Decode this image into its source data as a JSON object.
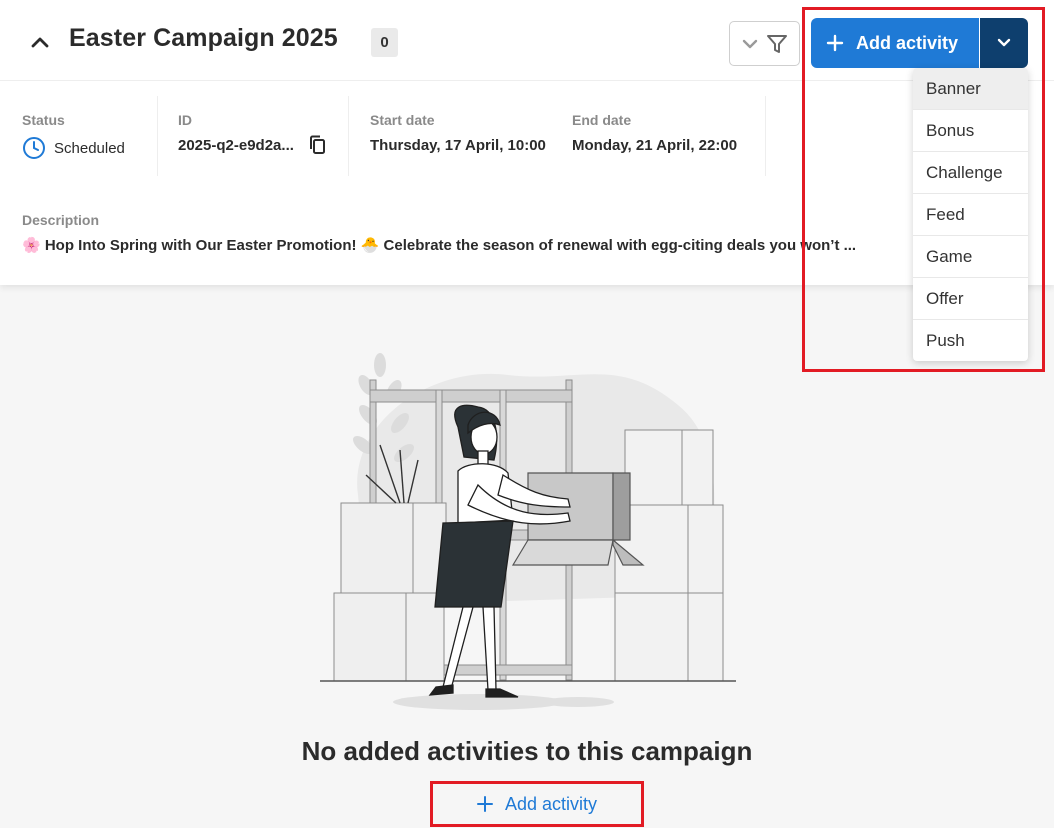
{
  "header": {
    "title": "Easter Campaign 2025",
    "count": "0",
    "add_activity_label": "Add activity"
  },
  "meta": {
    "status_label": "Status",
    "status_value": "Scheduled",
    "id_label": "ID",
    "id_value": "2025-q2-e9d2a...",
    "start_label": "Start date",
    "start_value": "Thursday, 17 April, 10:00",
    "end_label": "End date",
    "end_value": "Monday, 21 April, 22:00"
  },
  "description": {
    "label": "Description",
    "text": "🌸 Hop Into Spring with Our Easter Promotion! 🐣 Celebrate the season of renewal with egg-citing deals you won’t ..."
  },
  "dropdown": {
    "items": [
      "Banner",
      "Bonus",
      "Challenge",
      "Feed",
      "Game",
      "Offer",
      "Push"
    ]
  },
  "empty_state": {
    "title": "No added activities to this campaign",
    "add_label": "Add activity"
  },
  "colors": {
    "primary": "#1f7ad6",
    "primary_dark": "#0e3f6e",
    "highlight": "#e21b24",
    "status_icon": "#1f7ad6"
  },
  "icons": {
    "collapse": "chevron-up-icon",
    "filter_toggle": "chevron-down-icon",
    "filter": "filter-icon",
    "add": "plus-icon",
    "dropdown_toggle": "chevron-down-icon",
    "status": "clock-icon",
    "copy": "copy-icon"
  }
}
